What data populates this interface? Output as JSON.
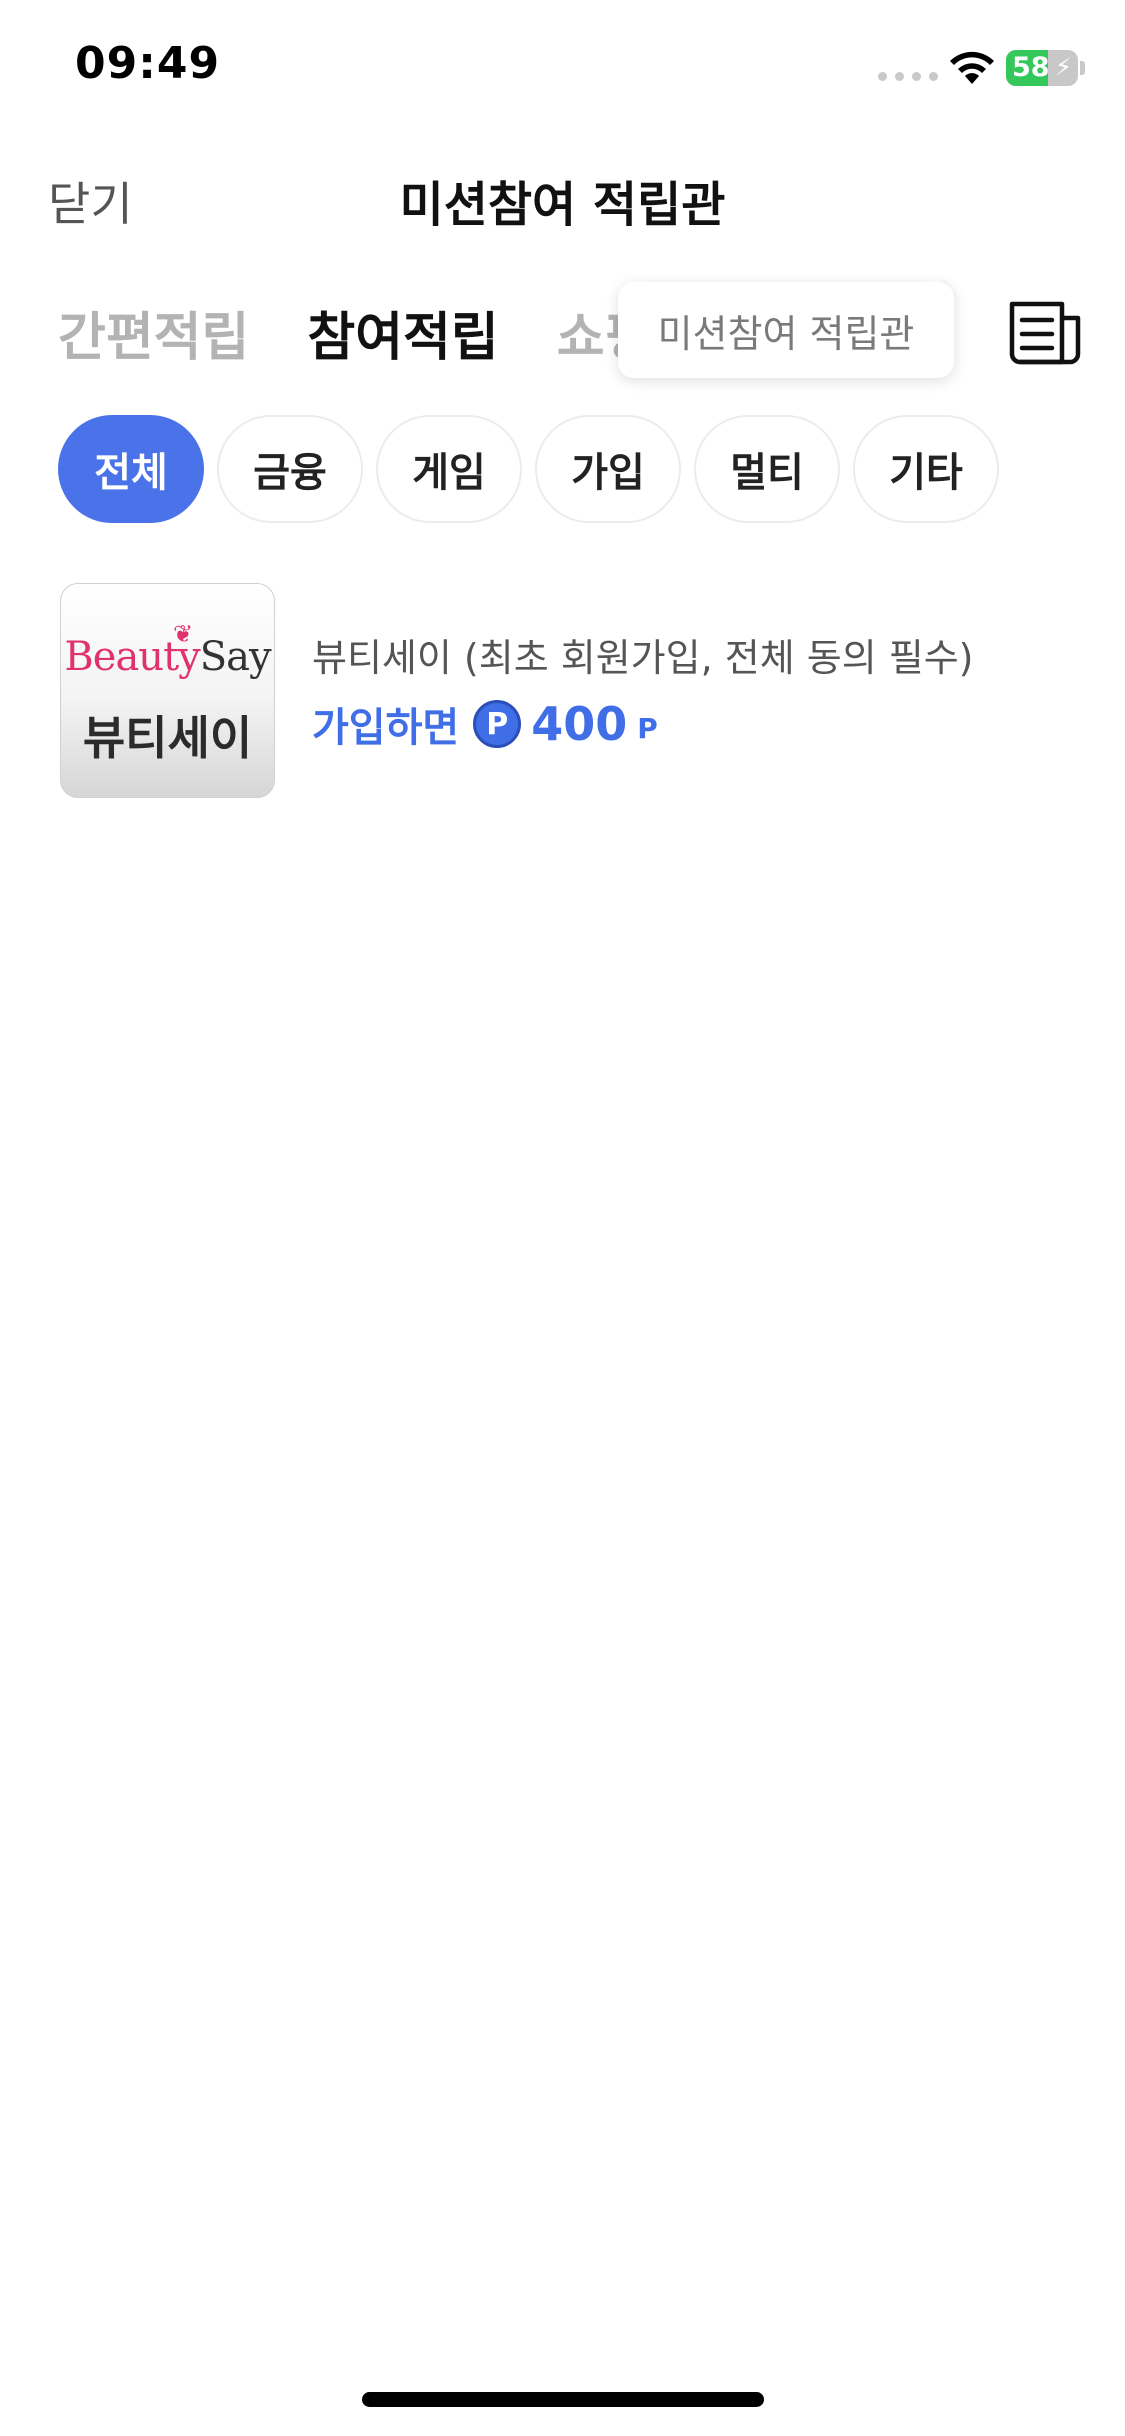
{
  "status_bar": {
    "time": "09:49",
    "battery_level": "58",
    "battery_percent": 58,
    "charging": true
  },
  "nav": {
    "close_label": "닫기",
    "title": "미션참여 적립관"
  },
  "tabs": [
    {
      "label": "간편적립",
      "active": false
    },
    {
      "label": "참여적립",
      "active": true
    },
    {
      "label": "쇼핑",
      "active": false
    }
  ],
  "tooltip": {
    "text": "미션참여 적립관"
  },
  "history_icon": "receipt-list-icon",
  "categories": [
    {
      "label": "전체",
      "active": true
    },
    {
      "label": "금융",
      "active": false
    },
    {
      "label": "게임",
      "active": false
    },
    {
      "label": "가입",
      "active": false
    },
    {
      "label": "멀티",
      "active": false
    },
    {
      "label": "기타",
      "active": false
    }
  ],
  "items": [
    {
      "thumb_logo_1": "Beauty",
      "thumb_logo_2": "Say",
      "thumb_name": "뷰티세이",
      "title": "뷰티세이 (최초 회원가입, 전체 동의 필수)",
      "reward_label": "가입하면",
      "point_symbol": "P",
      "reward_amount": "400",
      "reward_unit": "P"
    }
  ],
  "colors": {
    "accent": "#4a72e9",
    "reward": "#3f6ee6",
    "battery": "#34c759"
  }
}
